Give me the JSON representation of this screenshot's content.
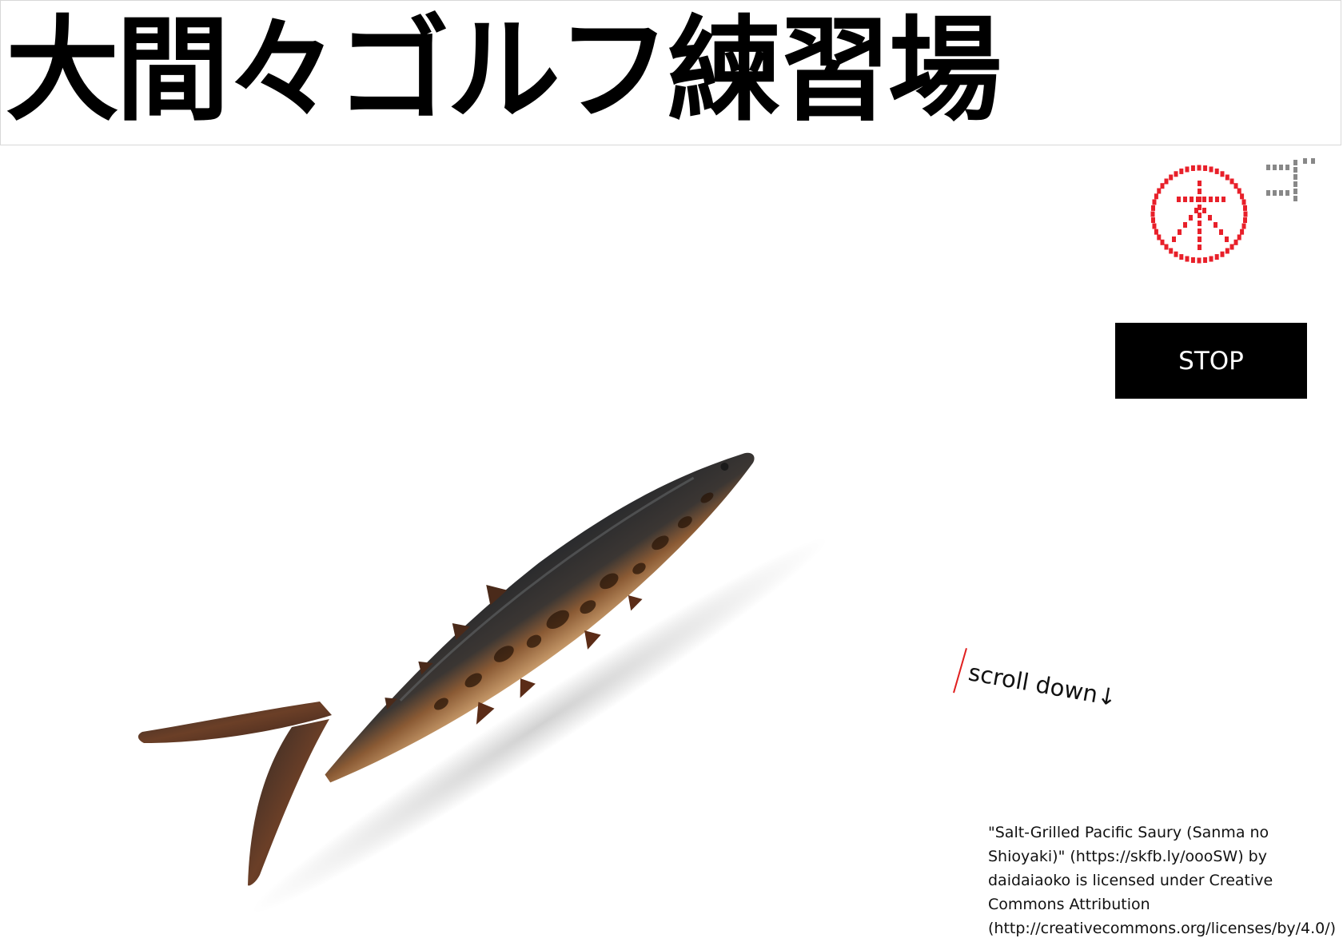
{
  "header": {
    "title": "大間々ゴルフ練習場"
  },
  "logo": {
    "icon": "dotted-circle-kanji-logo-icon",
    "colors": {
      "circle": "#e8202a",
      "mark": "#888888"
    }
  },
  "controls": {
    "stop_label": "STOP"
  },
  "scroll_hint": {
    "text": "scroll down↓",
    "accent": "#e02020"
  },
  "image": {
    "subject": "grilled-saury-fish-image"
  },
  "credit": {
    "text": "\"Salt-Grilled Pacific Saury (Sanma no Shioyaki)\" (https://skfb.ly/oooSW) by daidaiaoko is licensed under Creative Commons Attribution (http://creativecommons.org/licenses/by/4.0/)"
  }
}
